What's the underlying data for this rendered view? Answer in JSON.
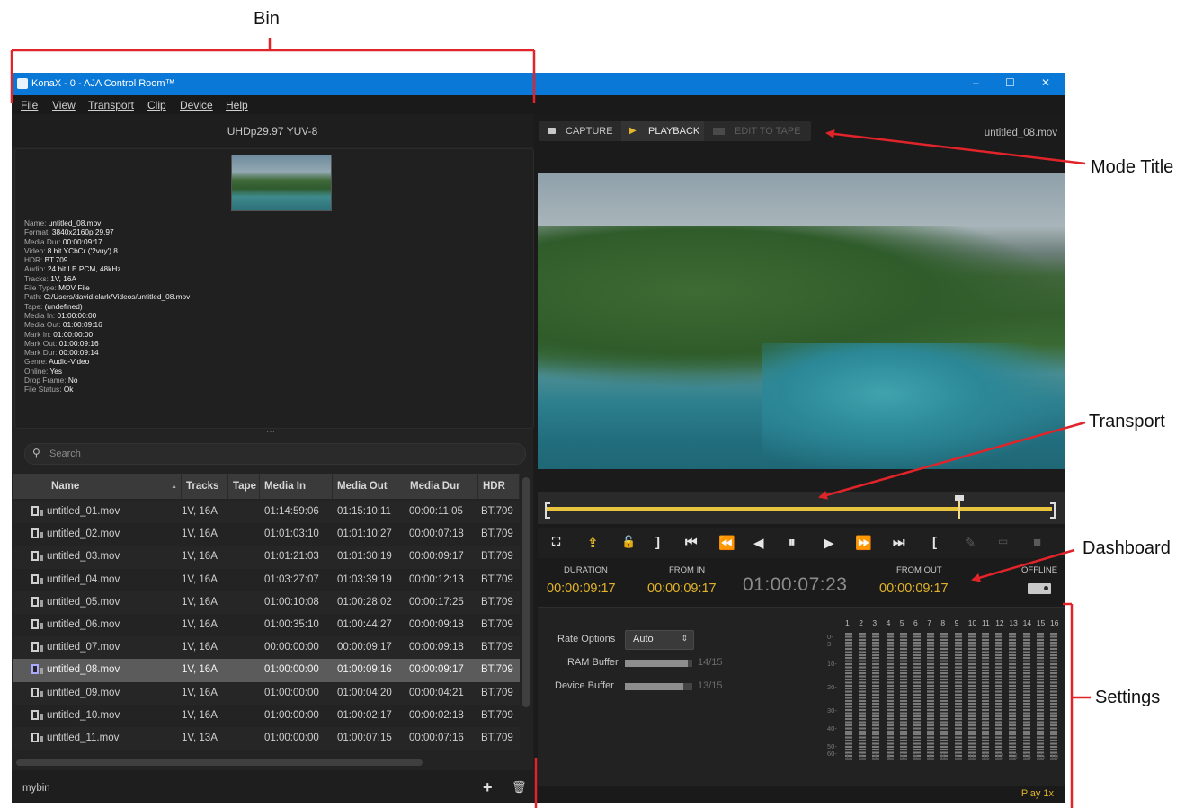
{
  "annotations": {
    "bin": "Bin",
    "mode_title": "Mode Title",
    "transport": "Transport",
    "dashboard": "Dashboard",
    "settings": "Settings"
  },
  "window": {
    "title": "KonaX - 0 - AJA Control Room™",
    "controls": [
      "–",
      "☐",
      "✕"
    ]
  },
  "menu": [
    "File",
    "View",
    "Transport",
    "Clip",
    "Device",
    "Help"
  ],
  "bin": {
    "format": "UHDp29.97 YUV-8",
    "metadata": [
      {
        "k": "Name:",
        "v": "untitled_08.mov"
      },
      {
        "k": "Format:",
        "v": "3840x2160p 29.97"
      },
      {
        "k": "Media Dur:",
        "v": "00:00:09:17"
      },
      {
        "k": "Video:",
        "v": "8 bit YCbCr ('2vuy') 8"
      },
      {
        "k": "HDR:",
        "v": "BT.709"
      },
      {
        "k": "Audio:",
        "v": "24 bit LE PCM, 48kHz"
      },
      {
        "k": "Tracks:",
        "v": "1V, 16A"
      },
      {
        "k": "File Type:",
        "v": "MOV File"
      },
      {
        "k": "Path:",
        "v": "C:/Users/david.clark/Videos/untitled_08.mov"
      },
      {
        "k": "Tape:",
        "v": "(undefined)"
      },
      {
        "k": "Media In:",
        "v": "01:00:00:00"
      },
      {
        "k": "Media Out:",
        "v": "01:00:09:16"
      },
      {
        "k": "Mark In:",
        "v": "01:00:00:00"
      },
      {
        "k": "Mark Out:",
        "v": "01:00:09:16"
      },
      {
        "k": "Mark Dur:",
        "v": "00:00:09:14"
      },
      {
        "k": "Genre:",
        "v": "Audio-Video"
      },
      {
        "k": "Online:",
        "v": "Yes"
      },
      {
        "k": "Drop Frame:",
        "v": "No"
      },
      {
        "k": "File Status:",
        "v": "Ok"
      }
    ],
    "divider": "···",
    "search_placeholder": "Search",
    "columns": [
      "Name",
      "Tracks",
      "Tape",
      "Media In",
      "Media Out",
      "Media Dur",
      "HDR"
    ],
    "sort_indicator": "▲",
    "rows": [
      {
        "name": "untitled_01.mov",
        "tracks": "1V, 16A",
        "tape": "",
        "in": "01:14:59:06",
        "out": "01:15:10:11",
        "dur": "00:00:11:05",
        "hdr": "BT.709"
      },
      {
        "name": "untitled_02.mov",
        "tracks": "1V, 16A",
        "tape": "",
        "in": "01:01:03:10",
        "out": "01:01:10:27",
        "dur": "00:00:07:18",
        "hdr": "BT.709"
      },
      {
        "name": "untitled_03.mov",
        "tracks": "1V, 16A",
        "tape": "",
        "in": "01:01:21:03",
        "out": "01:01:30:19",
        "dur": "00:00:09:17",
        "hdr": "BT.709"
      },
      {
        "name": "untitled_04.mov",
        "tracks": "1V, 16A",
        "tape": "",
        "in": "01:03:27:07",
        "out": "01:03:39:19",
        "dur": "00:00:12:13",
        "hdr": "BT.709"
      },
      {
        "name": "untitled_05.mov",
        "tracks": "1V, 16A",
        "tape": "",
        "in": "01:00:10:08",
        "out": "01:00:28:02",
        "dur": "00:00:17:25",
        "hdr": "BT.709"
      },
      {
        "name": "untitled_06.mov",
        "tracks": "1V, 16A",
        "tape": "",
        "in": "01:00:35:10",
        "out": "01:00:44:27",
        "dur": "00:00:09:18",
        "hdr": "BT.709"
      },
      {
        "name": "untitled_07.mov",
        "tracks": "1V, 16A",
        "tape": "",
        "in": "00:00:00:00",
        "out": "00:00:09:17",
        "dur": "00:00:09:18",
        "hdr": "BT.709"
      },
      {
        "name": "untitled_08.mov",
        "tracks": "1V, 16A",
        "tape": "",
        "in": "01:00:00:00",
        "out": "01:00:09:16",
        "dur": "00:00:09:17",
        "hdr": "BT.709",
        "selected": true
      },
      {
        "name": "untitled_09.mov",
        "tracks": "1V, 16A",
        "tape": "",
        "in": "01:00:00:00",
        "out": "01:00:04:20",
        "dur": "00:00:04:21",
        "hdr": "BT.709"
      },
      {
        "name": "untitled_10.mov",
        "tracks": "1V, 16A",
        "tape": "",
        "in": "01:00:00:00",
        "out": "01:00:02:17",
        "dur": "00:00:02:18",
        "hdr": "BT.709"
      },
      {
        "name": "untitled_11.mov",
        "tracks": "1V, 13A",
        "tape": "",
        "in": "01:00:00:00",
        "out": "01:00:07:15",
        "dur": "00:00:07:16",
        "hdr": "BT.709"
      }
    ],
    "bin_name": "mybin",
    "add_label": "+",
    "delete_label": "🗑"
  },
  "modes": {
    "tabs": [
      {
        "label": "CAPTURE",
        "icon": "camera-icon",
        "state": "normal"
      },
      {
        "label": "PLAYBACK",
        "icon": "play-icon",
        "state": "active"
      },
      {
        "label": "EDIT TO TAPE",
        "icon": "tape-icon",
        "state": "disabled"
      }
    ],
    "clip_name": "untitled_08.mov"
  },
  "timeline": {
    "playhead_fraction": 0.815
  },
  "transport_buttons": [
    "fullscreen-icon",
    "export-icon",
    "lock-icon",
    "mark-out-icon",
    "go-to-start-icon",
    "rewind-icon",
    "step-back-icon",
    "pause-icon",
    "step-forward-icon",
    "fast-forward-icon",
    "go-to-end-icon",
    "mark-in-icon",
    "pencil-icon",
    "tape-deck-icon",
    "record-icon"
  ],
  "dashboard": {
    "duration_label": "DURATION",
    "duration": "00:00:09:17",
    "from_in_label": "FROM IN",
    "from_in": "00:00:09:17",
    "timecode": "01:00:07:23",
    "from_out_label": "FROM OUT",
    "from_out": "00:00:09:17",
    "status_label": "OFFLINE"
  },
  "settings": {
    "rate_label": "Rate Options",
    "rate_value": "Auto",
    "ram_label": "RAM Buffer",
    "ram_value": "14/15",
    "ram_fraction": 0.933,
    "device_label": "Device Buffer",
    "device_value": "13/15",
    "device_fraction": 0.867,
    "channels": [
      "1",
      "2",
      "3",
      "4",
      "5",
      "6",
      "7",
      "8",
      "9",
      "10",
      "11",
      "12",
      "13",
      "14",
      "15",
      "16"
    ],
    "db_scale": [
      "0-",
      "3-",
      "10-",
      "20-",
      "30-",
      "40-",
      "50-",
      "60-"
    ]
  },
  "status": {
    "play_rate": "Play 1x"
  },
  "colors": {
    "accent": "#e2b327",
    "titlebar": "#0a78d7",
    "annotation": "#e0242a"
  }
}
